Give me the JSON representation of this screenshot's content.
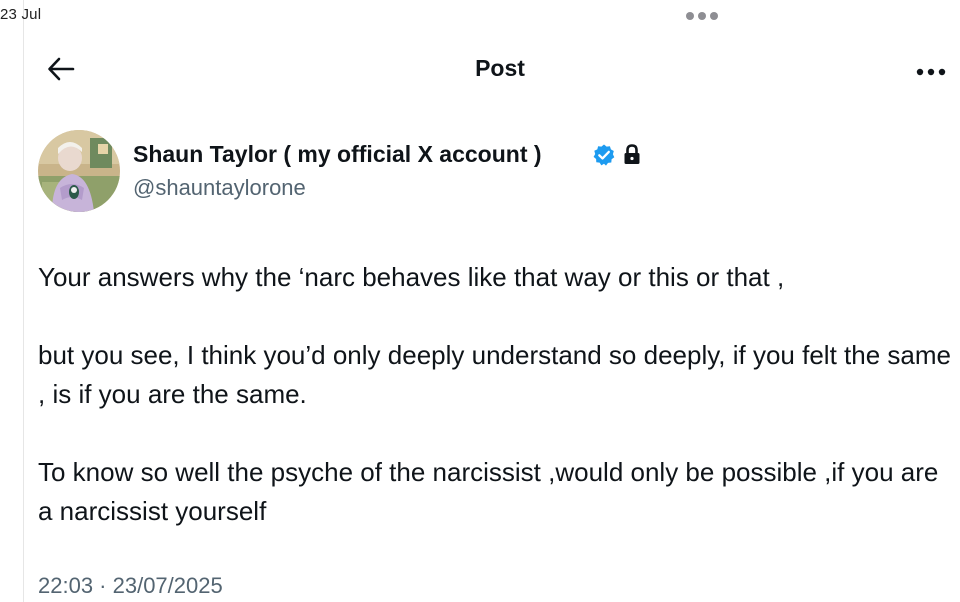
{
  "status_bar": {
    "date": "23 Jul"
  },
  "header": {
    "title": "Post",
    "back_icon": "arrow-left-icon",
    "more_icon": "more-horizontal-icon"
  },
  "author": {
    "display_name": "Shaun Taylor ( my official X account )",
    "handle": "@shauntaylorone",
    "verified": true,
    "protected": true,
    "verified_color": "#1d9bf0"
  },
  "post": {
    "paragraphs": [
      "Your answers why the ‘narc behaves like that way or this or that ,",
      "but you see, I think you’d only deeply understand so deeply, if you felt the same , is if you are the same.",
      "To know so well the psyche of the narcissist ,would only be possible ,if you are a narcissist yourself"
    ],
    "timestamp": "22:03 · 23/07/2025"
  }
}
